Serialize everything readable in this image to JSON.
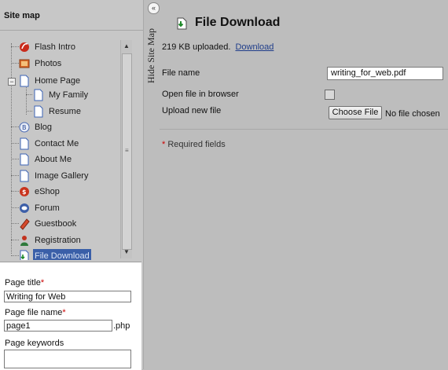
{
  "sidebar": {
    "title": "Site map",
    "items": [
      {
        "label": "Flash Intro",
        "icon": "flash-intro-icon"
      },
      {
        "label": "Photos",
        "icon": "photos-icon"
      },
      {
        "label": "Home Page",
        "icon": "page-icon"
      },
      {
        "label": "My Family",
        "icon": "page-icon"
      },
      {
        "label": "Resume",
        "icon": "page-icon"
      },
      {
        "label": "Blog",
        "icon": "blog-icon"
      },
      {
        "label": "Contact Me",
        "icon": "page-icon"
      },
      {
        "label": "About Me",
        "icon": "page-icon"
      },
      {
        "label": "Image Gallery",
        "icon": "image-gallery-icon"
      },
      {
        "label": "eShop",
        "icon": "eshop-icon"
      },
      {
        "label": "Forum",
        "icon": "forum-icon"
      },
      {
        "label": "Guestbook",
        "icon": "guestbook-icon"
      },
      {
        "label": "Registration",
        "icon": "registration-icon"
      },
      {
        "label": "File Download",
        "icon": "file-download-icon",
        "selected": true
      }
    ],
    "expander": "−",
    "scroll_grip": "≡",
    "hide_toggle": "«",
    "hide_label": "Hide Site Map"
  },
  "properties": {
    "page_title_label": "Page title",
    "page_title_value": "Writing for Web",
    "file_name_label": "Page file name",
    "file_name_value": "page1",
    "file_ext": ".php",
    "keywords_label": "Page keywords",
    "required_mark": "*"
  },
  "main": {
    "heading": "File Download",
    "status_text": "219 KB uploaded.",
    "download_link": "Download",
    "file_name_label": "File name",
    "file_name_value": "writing_for_web.pdf",
    "open_in_browser_label": "Open file in browser",
    "open_in_browser_checked": false,
    "upload_label": "Upload new file",
    "choose_button": "Choose File",
    "no_file_text": "No file chosen",
    "required_star": "*",
    "required_text": "Required fields"
  },
  "colors": {
    "selection": "#3a5fa8",
    "required": "#cc0000",
    "link": "#1f3d8a"
  }
}
